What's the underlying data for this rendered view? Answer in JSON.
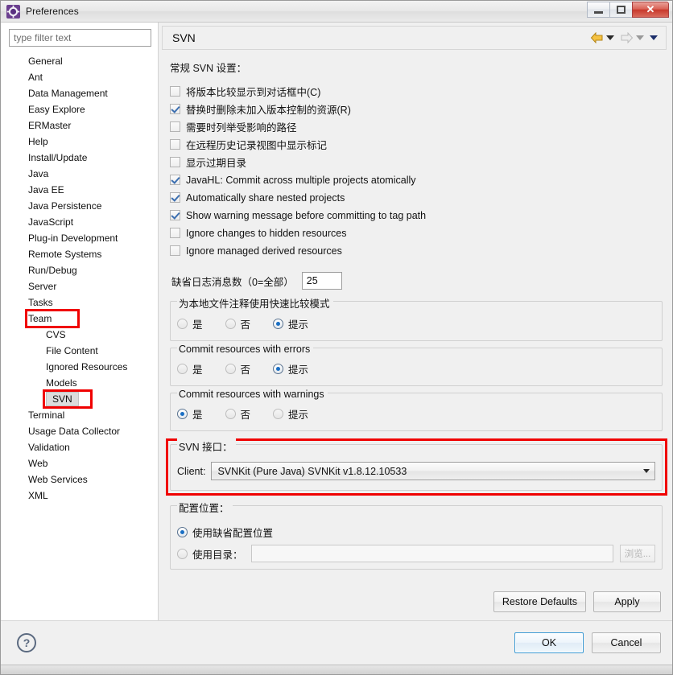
{
  "window": {
    "title": "Preferences",
    "icon": "gear-icon",
    "minimize_label": "–",
    "maximize_label": "□",
    "close_label": "✕"
  },
  "sidebar": {
    "filter_placeholder": "type filter text",
    "filter_value": "",
    "items": [
      {
        "label": "General",
        "level": 0,
        "selected": false
      },
      {
        "label": "Ant",
        "level": 0,
        "selected": false
      },
      {
        "label": "Data Management",
        "level": 0,
        "selected": false
      },
      {
        "label": "Easy Explore",
        "level": 0,
        "selected": false
      },
      {
        "label": "ERMaster",
        "level": 0,
        "selected": false
      },
      {
        "label": "Help",
        "level": 0,
        "selected": false
      },
      {
        "label": "Install/Update",
        "level": 0,
        "selected": false
      },
      {
        "label": "Java",
        "level": 0,
        "selected": false
      },
      {
        "label": "Java EE",
        "level": 0,
        "selected": false
      },
      {
        "label": "Java Persistence",
        "level": 0,
        "selected": false
      },
      {
        "label": "JavaScript",
        "level": 0,
        "selected": false
      },
      {
        "label": "Plug-in Development",
        "level": 0,
        "selected": false
      },
      {
        "label": "Remote Systems",
        "level": 0,
        "selected": false
      },
      {
        "label": "Run/Debug",
        "level": 0,
        "selected": false
      },
      {
        "label": "Server",
        "level": 0,
        "selected": false
      },
      {
        "label": "Tasks",
        "level": 0,
        "selected": false
      },
      {
        "label": "Team",
        "level": 0,
        "selected": false,
        "highlighted": true
      },
      {
        "label": "CVS",
        "level": 1,
        "selected": false
      },
      {
        "label": "File Content",
        "level": 1,
        "selected": false
      },
      {
        "label": "Ignored Resources",
        "level": 1,
        "selected": false
      },
      {
        "label": "Models",
        "level": 1,
        "selected": false
      },
      {
        "label": "SVN",
        "level": 1,
        "selected": true,
        "highlighted": true
      },
      {
        "label": "Terminal",
        "level": 0,
        "selected": false
      },
      {
        "label": "Usage Data Collector",
        "level": 0,
        "selected": false
      },
      {
        "label": "Validation",
        "level": 0,
        "selected": false
      },
      {
        "label": "Web",
        "level": 0,
        "selected": false
      },
      {
        "label": "Web Services",
        "level": 0,
        "selected": false
      },
      {
        "label": "XML",
        "level": 0,
        "selected": false
      }
    ]
  },
  "page": {
    "title": "SVN",
    "nav": {
      "back_icon": "back-arrow-icon",
      "back_menu_icon": "chevron-down-icon",
      "forward_icon": "forward-arrow-icon",
      "forward_menu_icon": "chevron-down-icon",
      "menu_icon": "chevron-down-icon"
    },
    "general_heading": "常规 SVN 设置：",
    "checkboxes": [
      {
        "label": "将版本比较显示到对话框中(C)",
        "checked": false
      },
      {
        "label": "替换时删除未加入版本控制的资源(R)",
        "checked": true
      },
      {
        "label": "需要时列举受影响的路径",
        "checked": false
      },
      {
        "label": "在远程历史记录视图中显示标记",
        "checked": false
      },
      {
        "label": "显示过期目录",
        "checked": false
      },
      {
        "label": "JavaHL: Commit across multiple projects atomically",
        "checked": true
      },
      {
        "label": "Automatically share nested projects",
        "checked": true
      },
      {
        "label": "Show warning message before committing to tag path",
        "checked": true
      },
      {
        "label": "Ignore changes to hidden resources",
        "checked": false
      },
      {
        "label": "Ignore managed derived resources",
        "checked": false
      }
    ],
    "log_count": {
      "label": "缺省日志消息数（0=全部）",
      "value": "25"
    },
    "radio_groups": [
      {
        "title": "为本地文件注释使用快速比较模式",
        "options": [
          {
            "label": "是",
            "selected": false
          },
          {
            "label": "否",
            "selected": false
          },
          {
            "label": "提示",
            "selected": true
          }
        ]
      },
      {
        "title": "Commit resources with errors",
        "options": [
          {
            "label": "是",
            "selected": false
          },
          {
            "label": "否",
            "selected": false
          },
          {
            "label": "提示",
            "selected": true
          }
        ]
      },
      {
        "title": "Commit resources with warnings",
        "options": [
          {
            "label": "是",
            "selected": true
          },
          {
            "label": "否",
            "selected": false
          },
          {
            "label": "提示",
            "selected": false
          }
        ]
      }
    ],
    "svn_interface": {
      "title": "SVN 接口：",
      "client_label": "Client:",
      "client_value": "SVNKit (Pure Java) SVNKit v1.8.12.10533",
      "dropdown_icon": "chevron-down-icon",
      "highlighted": true
    },
    "config_location": {
      "title": "配置位置：",
      "default_option": {
        "label": "使用缺省配置位置",
        "selected": true
      },
      "dir_option": {
        "label": "使用目录：",
        "selected": false
      },
      "dir_value": "",
      "browse_label": "浏览...",
      "browse_disabled": true
    },
    "restore_defaults_label": "Restore Defaults",
    "apply_label": "Apply"
  },
  "footer": {
    "help_icon": "question-mark-icon",
    "help_label": "?",
    "ok_label": "OK",
    "cancel_label": "Cancel"
  },
  "colors": {
    "annotation_red": "#f00000",
    "accent_blue": "#1a6fc4",
    "selection_gray": "#dcdcdc",
    "window_bg": "#f0f0f0"
  }
}
